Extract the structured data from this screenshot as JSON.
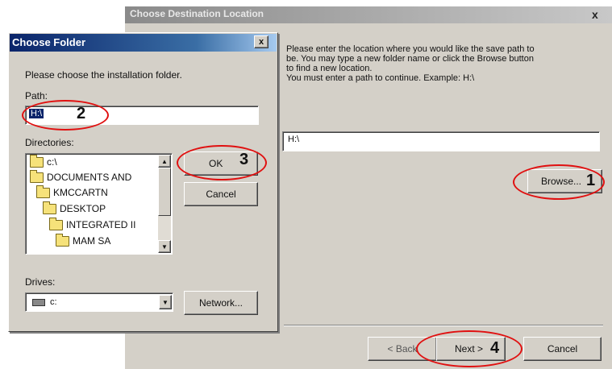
{
  "main_window": {
    "title": "Choose Destination Location",
    "close": "x",
    "description": [
      "Please enter the location where you would like the save path to",
      "be.  You may type a new folder name or click the Browse button",
      "to find a new location.",
      "You must enter a path to continue.  Example: H:\\"
    ],
    "path_value": "H:\\",
    "browse_label": "Browse...",
    "back_label": "< Back",
    "next_label": "Next >",
    "cancel_label": "Cancel"
  },
  "dialog": {
    "title": "Choose Folder",
    "close": "x",
    "prompt": "Please choose the installation folder.",
    "path_label": "Path:",
    "path_value": "H:\\",
    "directories_label": "Directories:",
    "directories": [
      "c:\\",
      "DOCUMENTS AND",
      "KMCCARTN",
      "DESKTOP",
      "INTEGRATED II",
      "MAM SA"
    ],
    "ok_label": "OK",
    "cancel_label": "Cancel",
    "drives_label": "Drives:",
    "drive_value": "c:",
    "network_label": "Network..."
  },
  "annotations": {
    "n1": "1",
    "n2": "2",
    "n3": "3",
    "n4": "4"
  },
  "colors": {
    "annotation": "#e01010",
    "titlebar_active": "#0a246a",
    "selection": "#0a246a"
  }
}
